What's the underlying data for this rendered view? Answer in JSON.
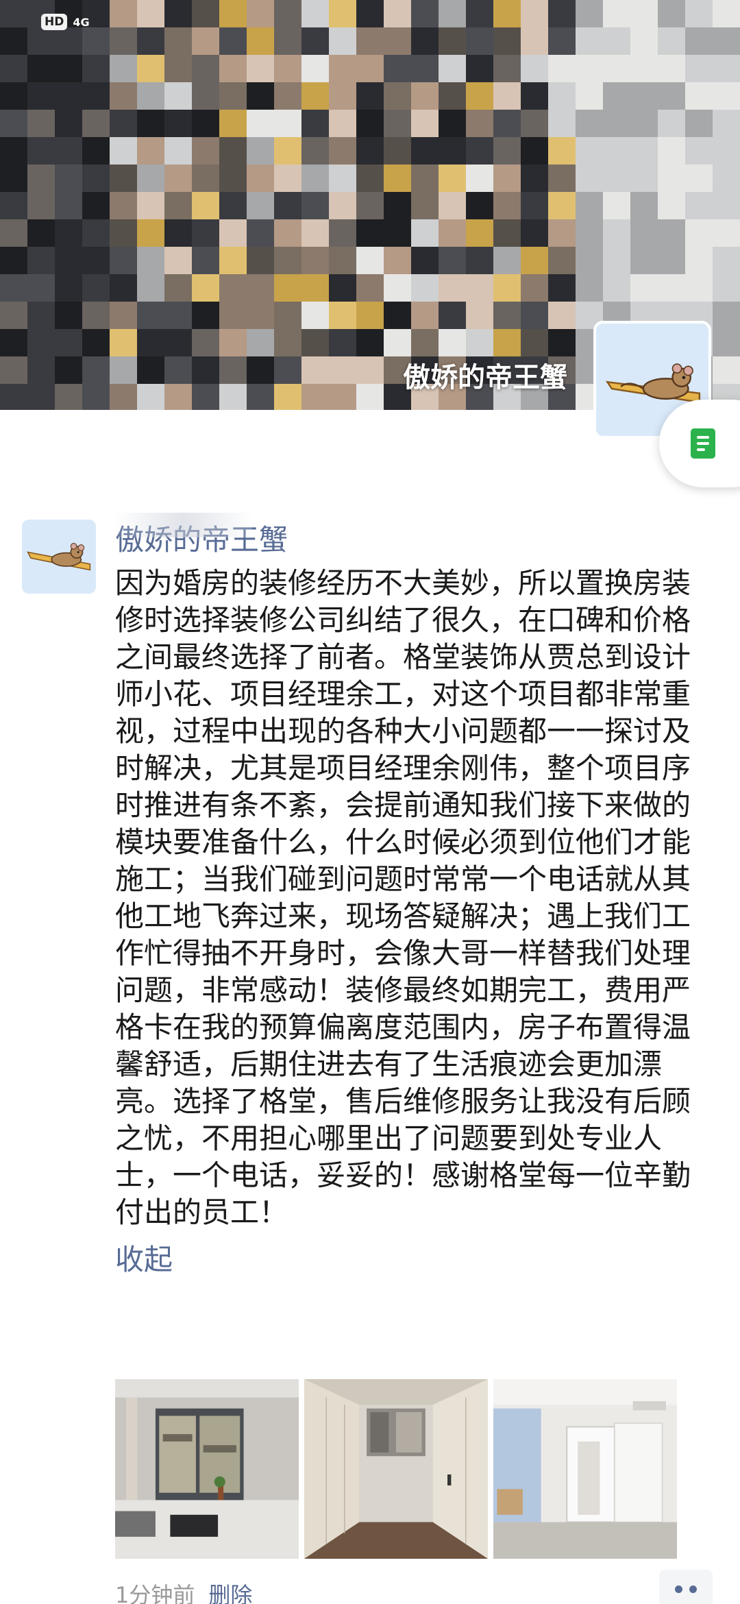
{
  "status_bar": {
    "hd": "HD",
    "network": "4G"
  },
  "cover": {
    "name": "傲娇的帝王蟹",
    "avatar_icon": "cartoon-mouse-avatar-icon"
  },
  "floating_button": {
    "icon": "document-icon",
    "color": "#2bb24c"
  },
  "post": {
    "nickname": "傲娇的帝王蟹",
    "content": "因为婚房的装修经历不大美妙，所以置换房装修时选择装修公司纠结了很久，在口碑和价格之间最终选择了前者。格堂装饰从贾总到设计师小花、项目经理余工，对这个项目都非常重视，过程中出现的各种大小问题都一一探讨及时解决，尤其是项目经理余刚伟，整个项目序时推进有条不紊，会提前通知我们接下来做的模块要准备什么，什么时候必须到位他们才能施工；当我们碰到问题时常常一个电话就从其他工地飞奔过来，现场答疑解决；遇上我们工作忙得抽不开身时，会像大哥一样替我们处理问题，非常感动！装修最终如期完工，费用严格卡在我的预算偏离度范围内，房子布置得温馨舒适，后期住进去有了生活痕迹会更加漂亮。选择了格堂，售后维修服务让我没有后顾之忧，不用担心哪里出了问题要到处专业人士，一个电话，妥妥的！感谢格堂每一位辛勤付出的员工！",
    "collapse_label": "收起",
    "photos": [
      "living-room-photo",
      "closet-hallway-photo",
      "bedroom-photo"
    ],
    "time": "1分钟前",
    "delete_label": "删除"
  },
  "colors": {
    "link": "#576b95",
    "meta": "#999999",
    "accent": "#2bb24c"
  }
}
